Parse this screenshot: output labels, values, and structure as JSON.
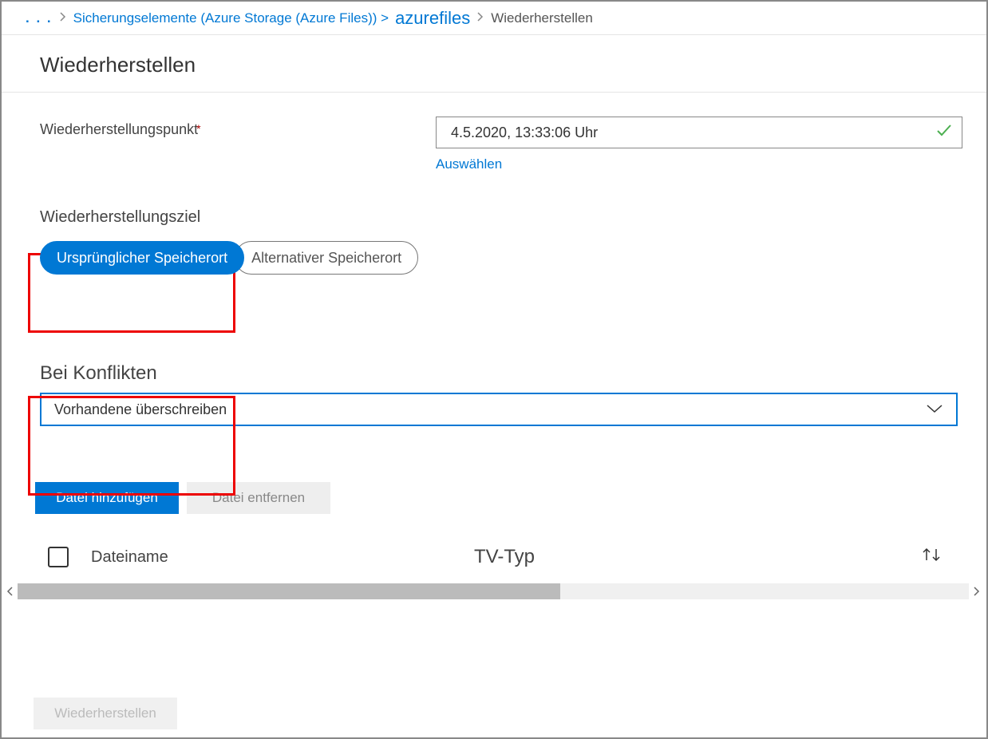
{
  "breadcrumb": {
    "ellipsis": ". . .",
    "item1": "Sicherungselemente (Azure Storage (Azure Files)) >",
    "item2": "azurefiles",
    "current": "Wiederherstellen"
  },
  "page_title": "Wiederherstellen",
  "restore_point": {
    "label": "Wiederherstellungspunkt",
    "value": "4.5.2020, 13:33:06 Uhr",
    "select_link": "Auswählen"
  },
  "destination": {
    "label": "Wiederherstellungsziel",
    "option1": "Ursprünglicher Speicherort",
    "option2": "Alternativer Speicherort"
  },
  "conflicts": {
    "label": "Bei Konflikten",
    "selected": "Vorhandene überschreiben"
  },
  "buttons": {
    "add_file": "Datei hinzufügen",
    "remove_file": "Datei entfernen",
    "restore": "Wiederherstellen"
  },
  "table": {
    "col_filename": "Dateiname",
    "col_type": "TV-Typ"
  }
}
